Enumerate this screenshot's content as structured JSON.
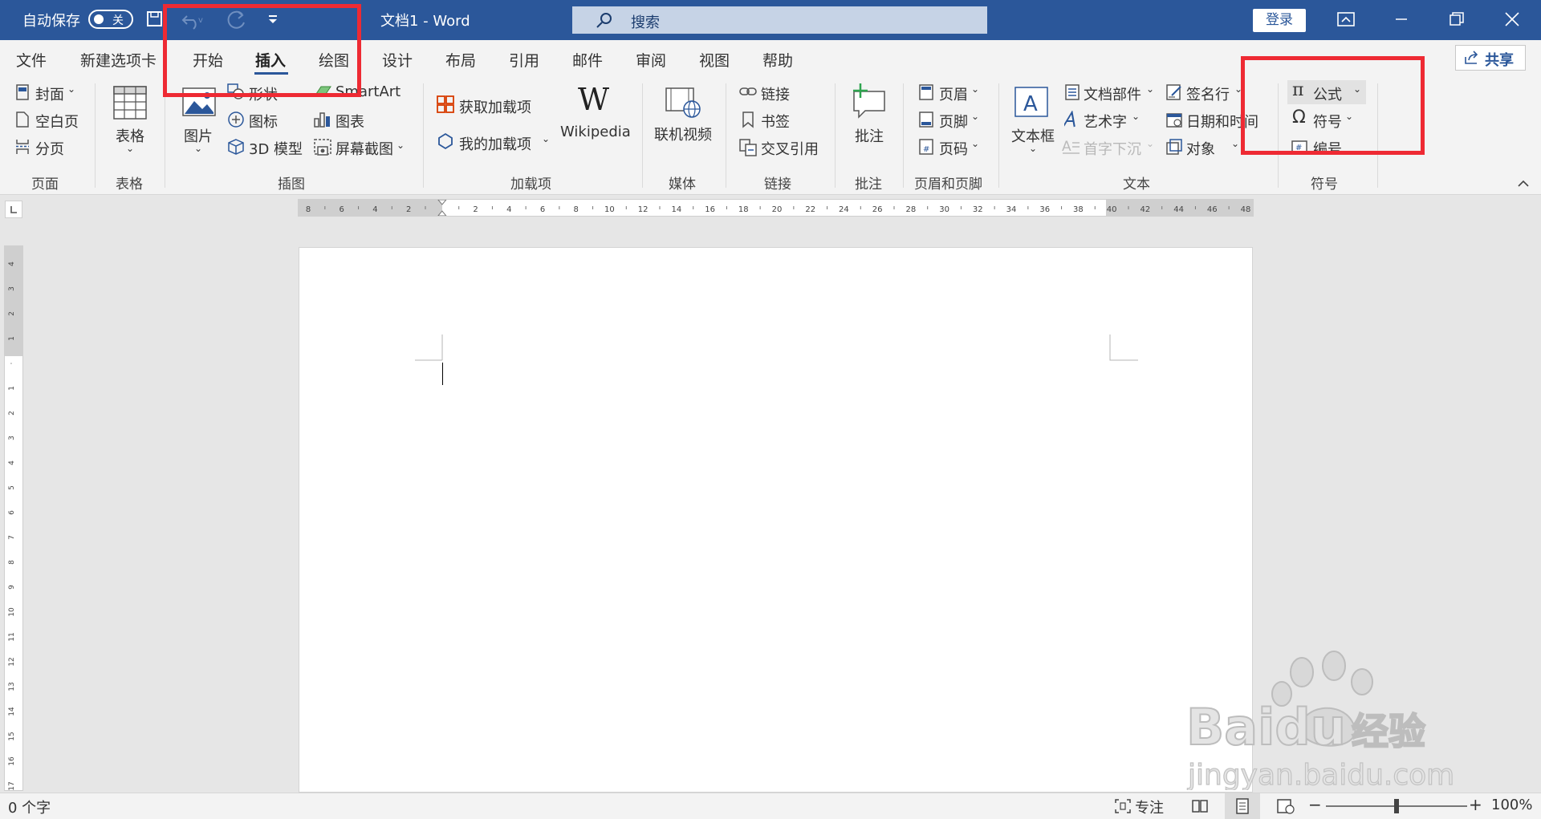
{
  "titlebar": {
    "autosave_label": "自动保存",
    "autosave_state": "关",
    "doc_title": "文档1  -  Word",
    "search_placeholder": "搜索",
    "login_label": "登录"
  },
  "tabs": [
    "文件",
    "新建选项卡",
    "开始",
    "插入",
    "绘图",
    "设计",
    "布局",
    "引用",
    "邮件",
    "审阅",
    "视图",
    "帮助"
  ],
  "active_tab": "插入",
  "share_label": "共享",
  "ribbon": {
    "page": {
      "cover": "封面",
      "blank_page": "空白页",
      "page_break": "分页",
      "group": "页面"
    },
    "table": {
      "table": "表格",
      "group": "表格"
    },
    "illustrations": {
      "picture": "图片",
      "shapes": "形状",
      "icons": "图标",
      "model3d": "3D 模型",
      "smartart": "SmartArt",
      "chart": "图表",
      "screenshot": "屏幕截图",
      "group": "插图"
    },
    "addins": {
      "get_addins": "获取加载项",
      "my_addins": "我的加载项",
      "wikipedia": "Wikipedia",
      "group": "加载项"
    },
    "media": {
      "online_video": "联机视频",
      "group": "媒体"
    },
    "links": {
      "link": "链接",
      "bookmark": "书签",
      "cross_ref": "交叉引用",
      "group": "链接"
    },
    "comments": {
      "comment": "批注",
      "group": "批注"
    },
    "header_footer": {
      "header": "页眉",
      "footer": "页脚",
      "page_number": "页码",
      "group": "页眉和页脚"
    },
    "text": {
      "textbox": "文本框",
      "quick_parts": "文档部件",
      "wordart": "艺术字",
      "dropcap": "首字下沉",
      "signature": "签名行",
      "datetime": "日期和时间",
      "object": "对象",
      "group": "文本"
    },
    "symbols": {
      "equation": "公式",
      "symbol": "符号",
      "number": "编号",
      "group": "符号"
    }
  },
  "hruler_labels": [
    "8",
    "6",
    "4",
    "2",
    "",
    "2",
    "4",
    "6",
    "8",
    "10",
    "12",
    "14",
    "16",
    "18",
    "20",
    "22",
    "24",
    "26",
    "28",
    "30",
    "32",
    "34",
    "36",
    "38",
    "40",
    "42",
    "44",
    "46",
    "48"
  ],
  "vruler_labels": [
    "4",
    "3",
    "2",
    "1",
    "",
    "1",
    "2",
    "3",
    "4",
    "5",
    "6",
    "7",
    "8",
    "9",
    "10",
    "11",
    "12",
    "13",
    "14",
    "15",
    "16",
    "17"
  ],
  "status": {
    "word_count": "0 个字",
    "focus": "专注",
    "zoom": "100%",
    "zoom_level": 1.0
  },
  "watermark": {
    "brand": "Baidu",
    "suffix": "经验",
    "url": "jingyan.baidu.com"
  },
  "colors": {
    "titlebar": "#2b579a",
    "highlight": "#ee2a33"
  }
}
